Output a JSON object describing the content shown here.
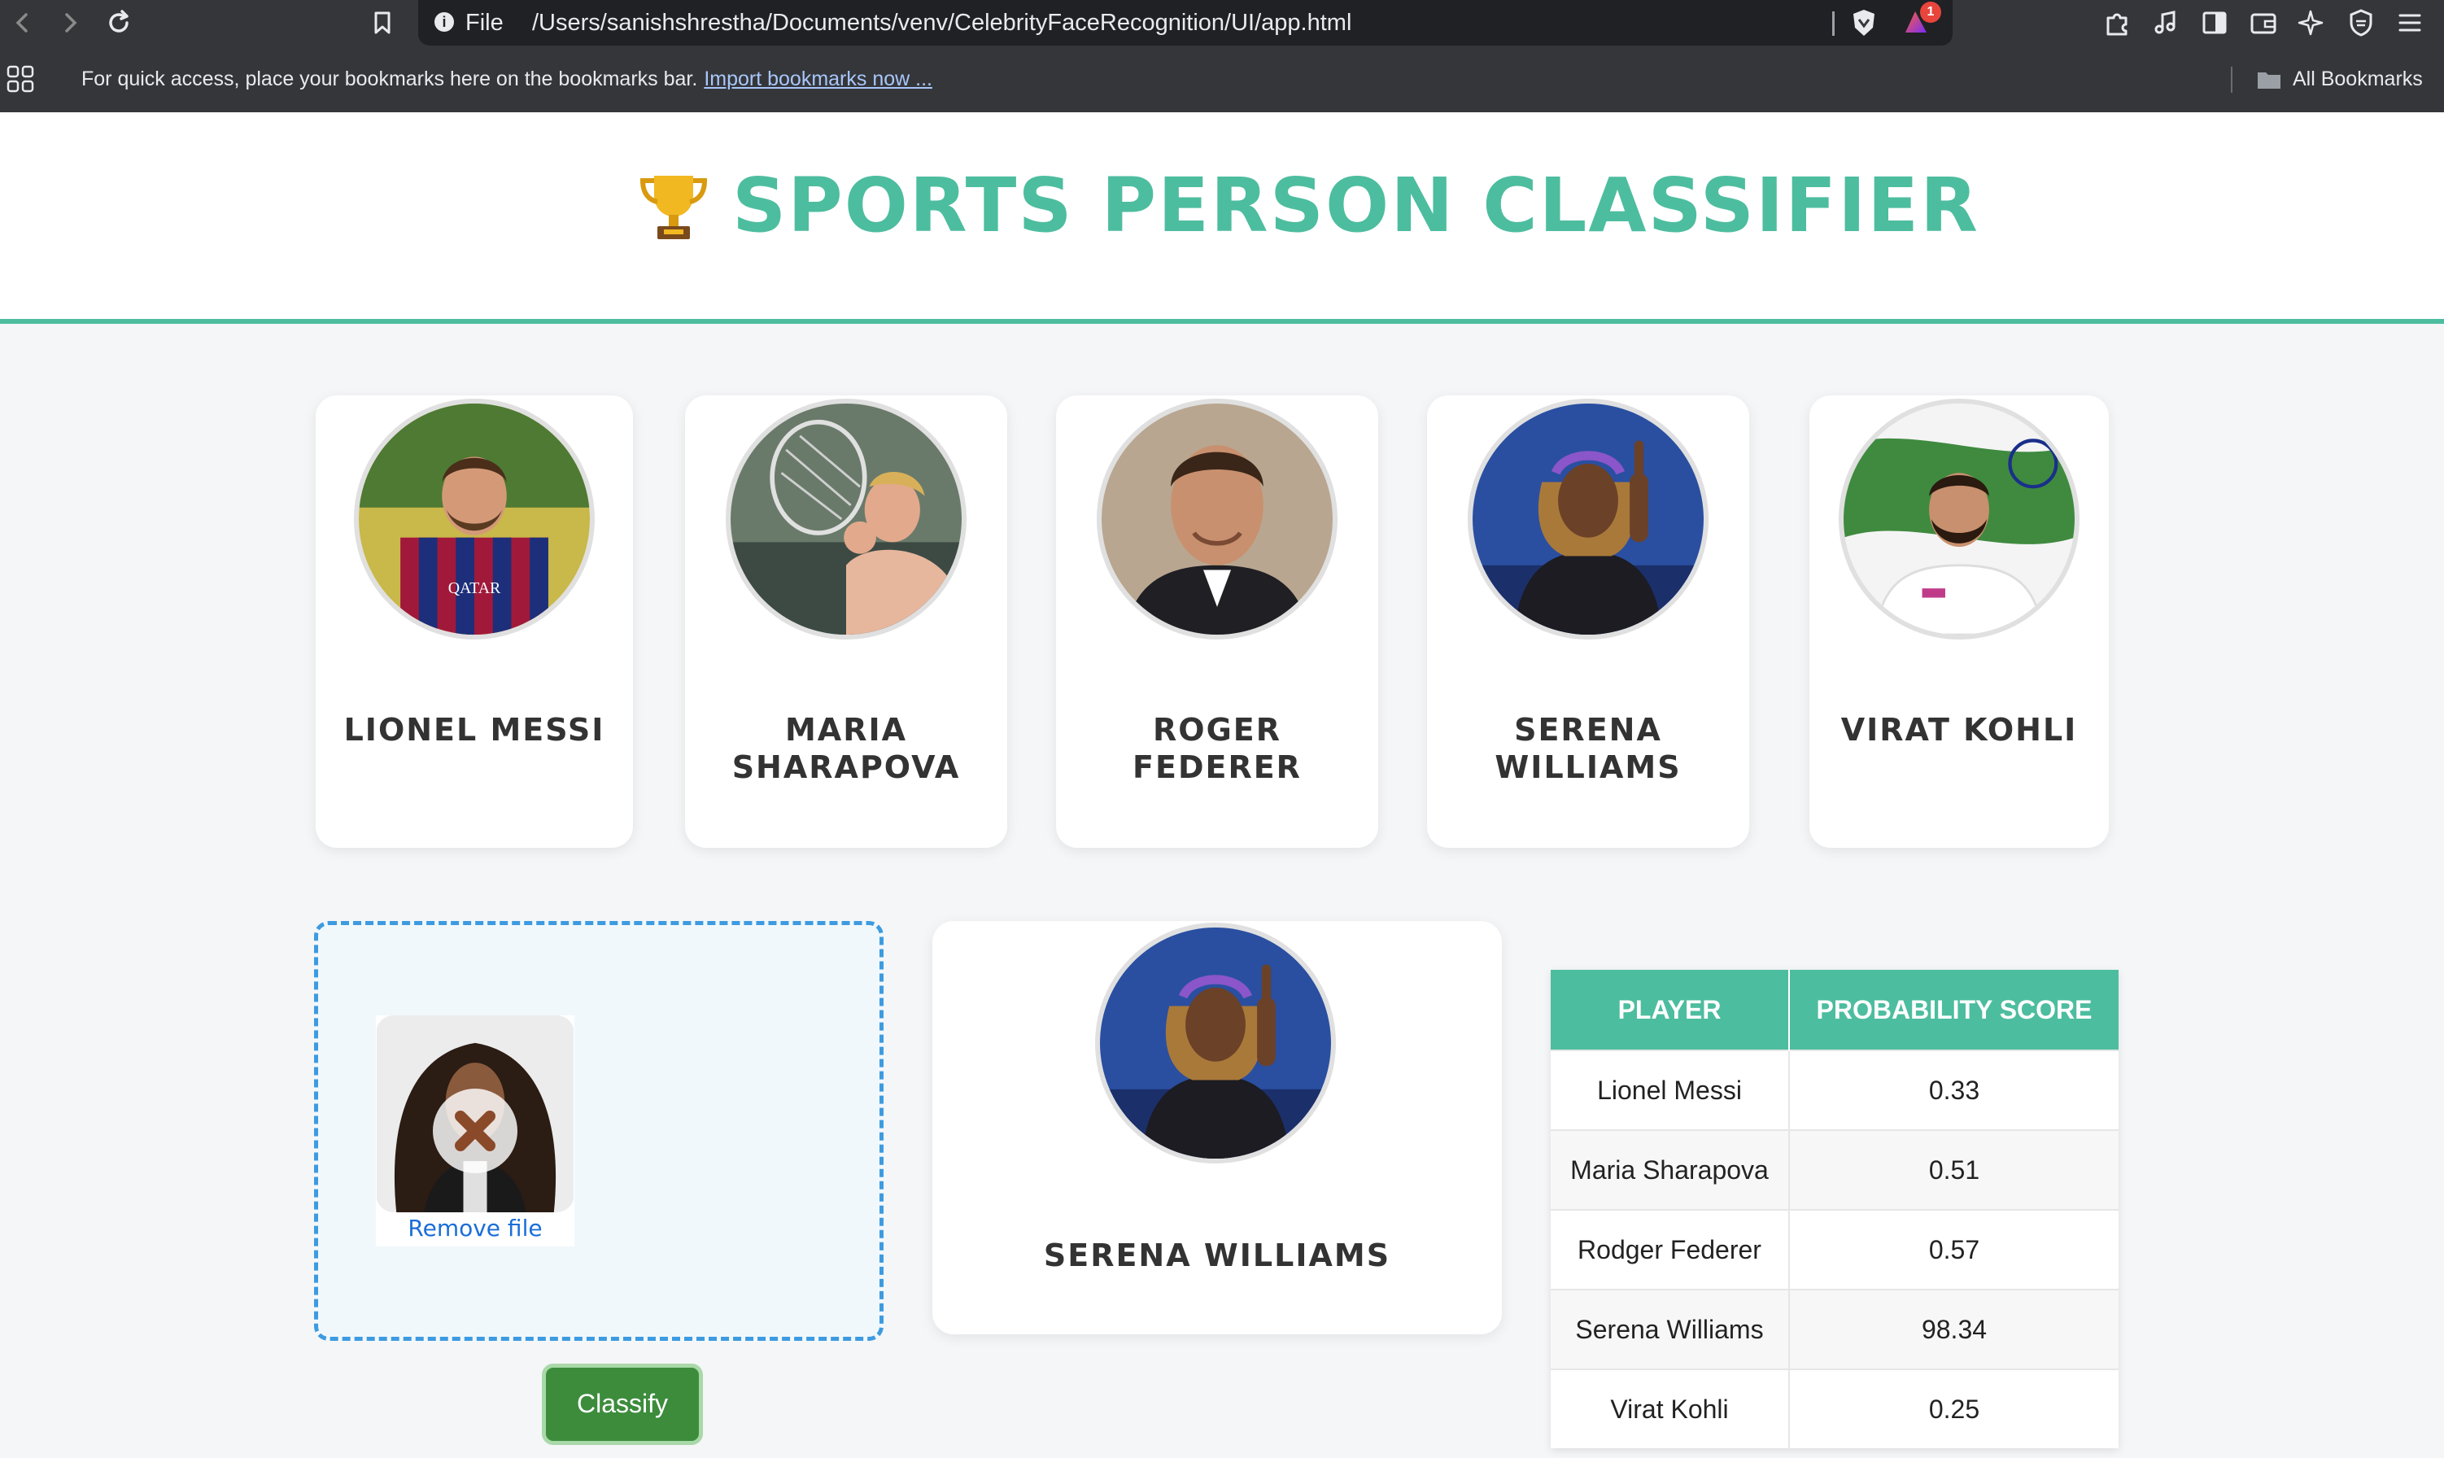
{
  "browser": {
    "url_scheme": "File",
    "url_path": "/Users/sanishshrestha/Documents/venv/CelebrityFaceRecognition/UI/app.html",
    "rewards_badge_count": "1",
    "bookmarks_bar_text": "For quick access, place your bookmarks here on the bookmarks bar.",
    "import_bookmarks_link": "Import bookmarks now ...",
    "all_bookmarks_label": "All Bookmarks"
  },
  "header": {
    "title": "SPORTS PERSON CLASSIFIER",
    "accent_color": "#4dbd9f"
  },
  "players": [
    {
      "line1": "LIONEL MESSI",
      "line2": ""
    },
    {
      "line1": "MARIA",
      "line2": "SHARAPOVA"
    },
    {
      "line1": "ROGER",
      "line2": "FEDERER"
    },
    {
      "line1": "SERENA",
      "line2": "WILLIAMS"
    },
    {
      "line1": "VIRAT KOHLI",
      "line2": ""
    }
  ],
  "upload": {
    "remove_file_label": "Remove file",
    "classify_label": "Classify"
  },
  "result": {
    "name": "SERENA WILLIAMS"
  },
  "table": {
    "headers": [
      "PLAYER",
      "PROBABILITY SCORE"
    ],
    "rows": [
      {
        "player": "Lionel Messi",
        "score": "0.33"
      },
      {
        "player": "Maria Sharapova",
        "score": "0.51"
      },
      {
        "player": "Rodger Federer",
        "score": "0.57"
      },
      {
        "player": "Serena Williams",
        "score": "98.34"
      },
      {
        "player": "Virat Kohli",
        "score": "0.25"
      }
    ]
  }
}
